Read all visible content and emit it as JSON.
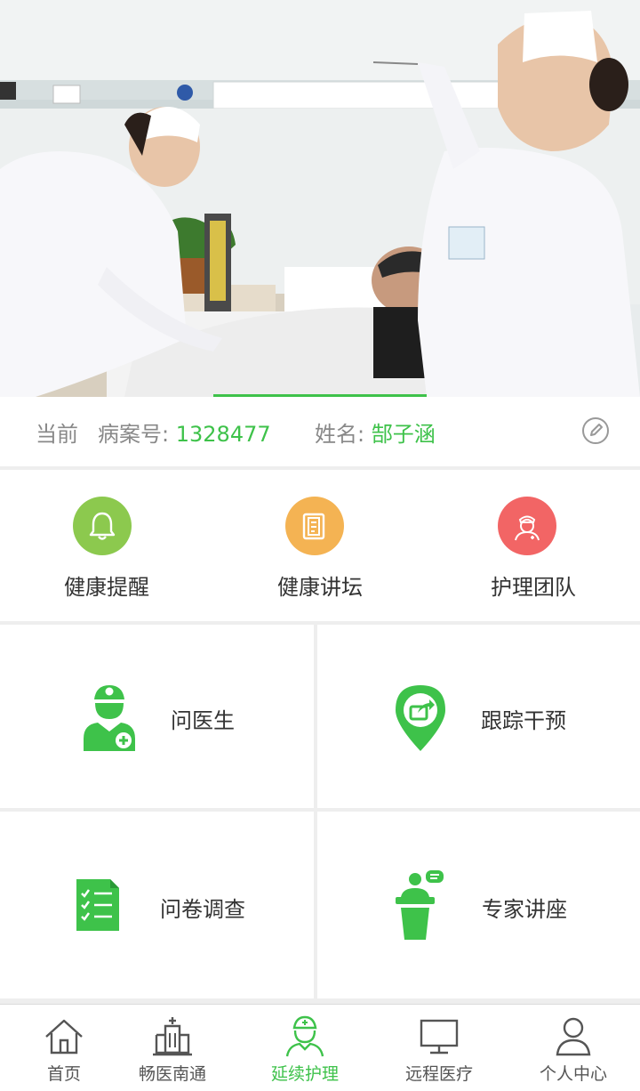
{
  "banner": {
    "image_alt": "nurses caring for patient",
    "indicator_color": "#3ec24a"
  },
  "patient": {
    "current_label": "当前",
    "case_label": "病案号:",
    "case_value": "1328477",
    "name_label": "姓名:",
    "name_value": "郜子涵",
    "edit_icon": "edit-icon"
  },
  "quick": [
    {
      "label": "健康提醒",
      "icon": "bell-icon",
      "color": "#8cc94e"
    },
    {
      "label": "健康讲坛",
      "icon": "document-icon",
      "color": "#f4b353"
    },
    {
      "label": "护理团队",
      "icon": "nurse-icon",
      "color": "#f26565"
    }
  ],
  "grid": [
    {
      "label": "问医生",
      "icon": "doctor-icon"
    },
    {
      "label": "跟踪干预",
      "icon": "location-share-icon"
    },
    {
      "label": "问卷调查",
      "icon": "checklist-icon"
    },
    {
      "label": "专家讲座",
      "icon": "lecture-icon"
    }
  ],
  "nav": [
    {
      "label": "首页",
      "icon": "home-icon",
      "active": false
    },
    {
      "label": "畅医南通",
      "icon": "hospital-icon",
      "active": false
    },
    {
      "label": "延续护理",
      "icon": "nurse-care-icon",
      "active": true
    },
    {
      "label": "远程医疗",
      "icon": "monitor-icon",
      "active": false
    },
    {
      "label": "个人中心",
      "icon": "person-icon",
      "active": false
    }
  ],
  "colors": {
    "accent": "#3ec24a",
    "muted": "#888888"
  }
}
